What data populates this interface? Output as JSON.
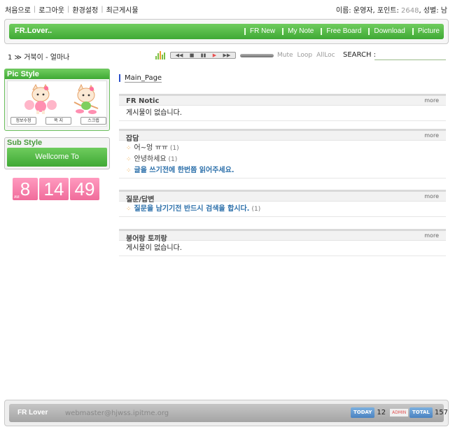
{
  "top": {
    "links": [
      "처음으로",
      "로그아웃",
      "환경설정",
      "최근게시물"
    ],
    "user_name_label": "이름:",
    "user_name": "운영자,",
    "point_label": "포인트:",
    "points": "2648",
    "gender_label": "성별:",
    "gender": "남"
  },
  "nav": {
    "brand": "FR.Lover..",
    "items": [
      "FR New",
      "My Note",
      "Free Board",
      "Download",
      "Picture"
    ],
    "accent": "#4db842"
  },
  "music": {
    "now_playing": "1 ≫ 거북이 - 얼마나",
    "controls": [
      "◀◀",
      "■",
      "▮▮",
      "▶",
      "▶▶"
    ],
    "options": [
      "Mute",
      "Loop",
      "AllLoc"
    ],
    "search_label": "SEARCH :",
    "search_placeholder": ""
  },
  "sidebar": {
    "pic_style_title": "Pic Style",
    "pic_buttons": [
      "정보수정",
      "쪽 지",
      "스크랩"
    ],
    "sub_style_title": "Sub Style",
    "welcome": "Wellcome To",
    "clock": {
      "ampm": "AM",
      "hour": "8",
      "minute": "14",
      "second": "49"
    }
  },
  "main": {
    "page_title": "Main_Page",
    "more_label": "more",
    "boards": [
      {
        "title": "FR Notic",
        "empty": "게시물이 없습니다."
      },
      {
        "title": "잡담",
        "posts": [
          {
            "title": "어~엉 ㅠㅠ",
            "count": "(1)",
            "hot": false
          },
          {
            "title": "안녕하세요",
            "count": "(1)",
            "hot": false
          },
          {
            "title": "글을 쓰기전에 한번쯤 읽어주세요.",
            "count": "",
            "hot": true
          }
        ]
      },
      {
        "title": "질문/답변",
        "posts": [
          {
            "title": "질문을 남기기전 반드시 검색을 합시다.",
            "count": "(1)",
            "hot": true
          }
        ]
      },
      {
        "title": "붕어랑 토끼랑",
        "empty": "게시물이 없습니다."
      }
    ]
  },
  "footer": {
    "brand": "FR Lover",
    "email": "webmaster@hjwss.ipitme.org",
    "today_label": "TODAY",
    "today": "12",
    "admin_label": "ADMIN",
    "total_label": "TOTAL",
    "total": "157"
  }
}
